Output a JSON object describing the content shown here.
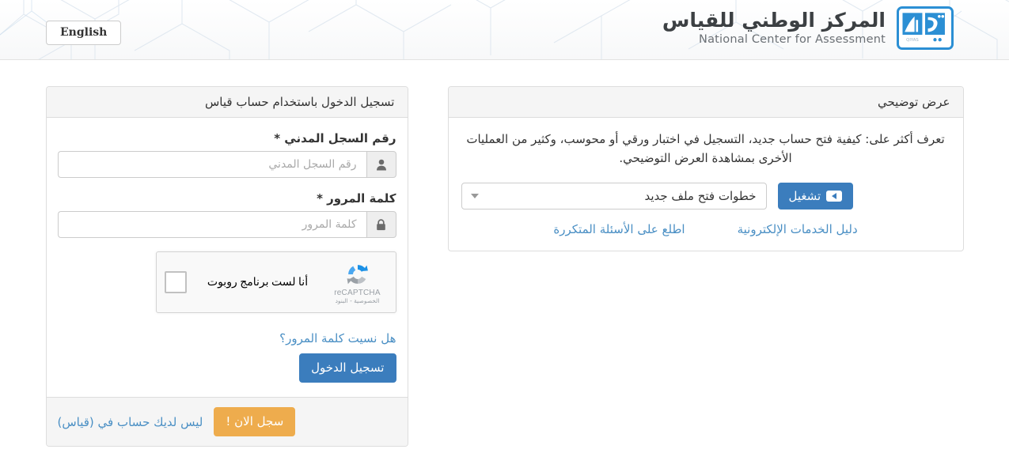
{
  "header": {
    "lang_button": "English",
    "brand_arabic": "المركز الوطني للقياس",
    "brand_english": "National Center for Assessment",
    "logo_text": "QIYAS"
  },
  "login": {
    "title": "تسجيل الدخول باستخدام حساب قياس",
    "national_id_label": "رقم السجل المدني *",
    "national_id_placeholder": "رقم السجل المدني",
    "national_id_value": "",
    "password_label": "كلمة المرور *",
    "password_placeholder": "كلمة المرور",
    "password_value": "",
    "recaptcha": {
      "label": "أنا لست برنامج روبوت",
      "brand": "reCAPTCHA",
      "terms": "الخصوصية - البنود",
      "checked": false
    },
    "forgot_password": "هل نسيت كلمة المرور؟",
    "submit_button": "تسجيل الدخول",
    "footer_text": "ليس لديك حساب في (قياس)",
    "register_button": "سجل الان !"
  },
  "demo": {
    "title": "عرض توضيحي",
    "description": "تعرف أكثر على: كيفية فتح حساب جديد، التسجيل في اختبار ورقي أو محوسب، وكثير من العمليات الأخرى بمشاهدة العرض التوضيحي.",
    "select_value": "خطوات فتح ملف جديد",
    "play_button": "تشغيل",
    "link_faq": "اطلع على الأسئلة المتكررة",
    "link_guide": "دليل الخدمات الإلكترونية"
  },
  "colors": {
    "primary": "#3b7dbd",
    "warning": "#eeac4d",
    "link": "#4a8fc4",
    "logo_blue": "#2b8fd4",
    "panel_header_bg": "#f5f5f5",
    "border": "#dddddd"
  }
}
